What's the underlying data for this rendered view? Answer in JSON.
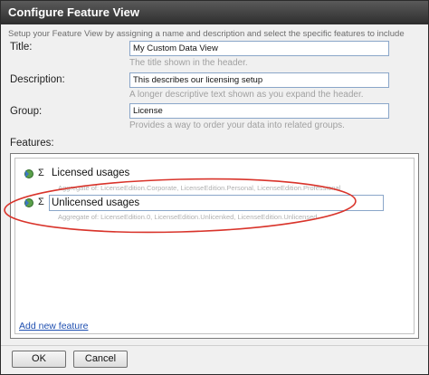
{
  "window": {
    "title": "Configure Feature View"
  },
  "intro_text": "Setup your Feature View by assigning a name and description and select the specific features to include",
  "form": {
    "title_label": "Title:",
    "title_value": "My Custom Data View",
    "title_hint": "The title shown in the header.",
    "description_label": "Description:",
    "description_value": "This describes our licensing setup",
    "description_hint": "A longer descriptive text shown as you expand the header.",
    "group_label": "Group:",
    "group_value": "License",
    "group_hint": "Provides a way to order your data into related groups."
  },
  "features": {
    "label": "Features:",
    "sigma": "Σ",
    "items": [
      {
        "name": "Licensed usages",
        "aggregate": "Aggregate of:  LicenseEdition.Corporate, LicenseEdition.Personal, LicenseEdition.Professional"
      },
      {
        "name": "Unlicensed usages",
        "aggregate": "Aggregate of:  LicenseEdition.0, LicenseEdition.Unlicenked, LicenseEdition.Unlicensed"
      }
    ],
    "add_link": "Add new feature"
  },
  "buttons": {
    "ok": "OK",
    "cancel": "Cancel"
  },
  "colors": {
    "highlight_ellipse": "#d9342b",
    "link": "#1f4fb0"
  }
}
